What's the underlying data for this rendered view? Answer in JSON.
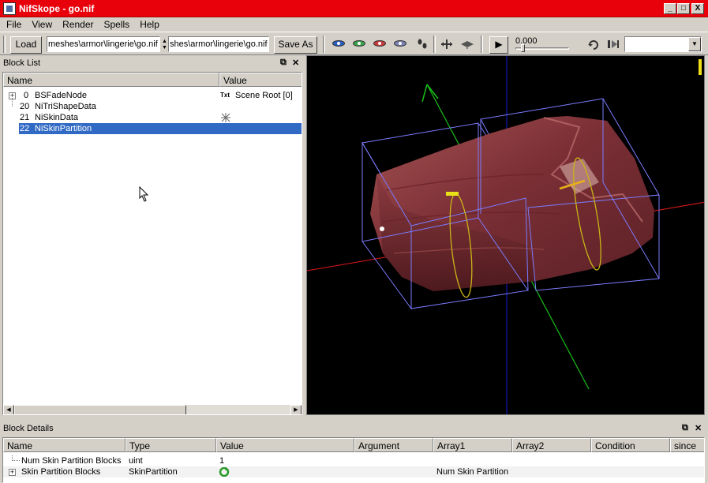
{
  "window": {
    "title": "NifSkope - go.nif",
    "minimize": "_",
    "maximize": "□",
    "close": "X"
  },
  "menu": [
    "File",
    "View",
    "Render",
    "Spells",
    "Help"
  ],
  "toolbar": {
    "load_label": "Load",
    "load_path": "meshes\\armor\\lingerie\\go.nif",
    "save_path": "shes\\armor\\lingerie\\go.nif",
    "save_as_label": "Save As",
    "time_value": "0.000",
    "play_label": "▶"
  },
  "block_list": {
    "title": "Block List",
    "columns": [
      "Name",
      "Value"
    ],
    "rows": [
      {
        "index": "0",
        "name": "BSFadeNode",
        "value_prefix": "Txt",
        "value": "Scene Root [0]",
        "expandable": true
      },
      {
        "index": "20",
        "name": "NiTriShapeData",
        "value_prefix": "",
        "value": "",
        "expandable": false
      },
      {
        "index": "21",
        "name": "NiSkinData",
        "value_prefix": "",
        "value": "",
        "expandable": false
      },
      {
        "index": "22",
        "name": "NiSkinPartition",
        "value_prefix": "",
        "value": "",
        "expandable": false,
        "selected": true
      }
    ]
  },
  "block_details": {
    "title": "Block Details",
    "columns": [
      "Name",
      "Type",
      "Value",
      "Argument",
      "Array1",
      "Array2",
      "Condition",
      "since"
    ],
    "rows": [
      {
        "name": "Num Skin Partition Blocks",
        "type": "uint",
        "value": "1",
        "argument": "",
        "array1": "",
        "expandable": false
      },
      {
        "name": "Skin Partition Blocks",
        "type": "SkinPartition",
        "value": "",
        "argument": "",
        "array1": "Num Skin Partition",
        "expandable": true
      }
    ]
  },
  "colors": {
    "titlebar": "#e8000a",
    "selection": "#316ac5",
    "mesh": "#8a3a3a",
    "bbox": "#7b7bff",
    "axis_x": "#ff2020",
    "axis_y": "#20c020",
    "axis_z": "#2020ff"
  }
}
